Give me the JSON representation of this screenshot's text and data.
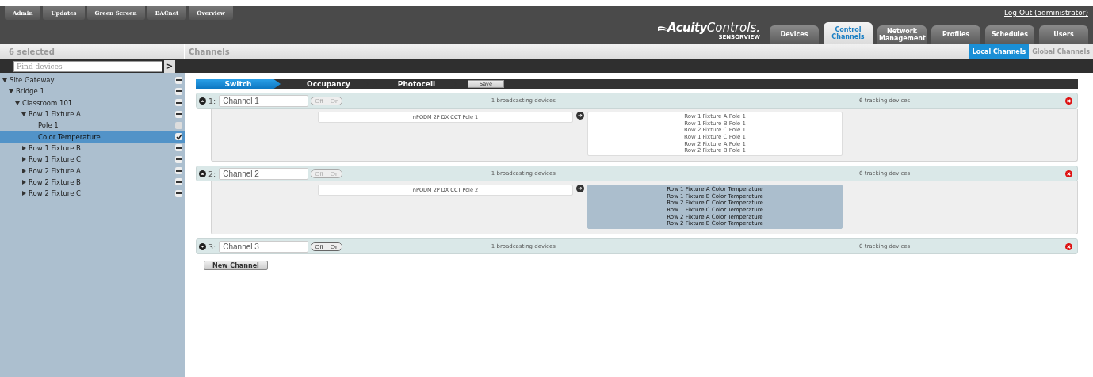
{
  "top_buttons": [
    "Admin",
    "Updates",
    "Green Screen",
    "BACnet",
    "Overview"
  ],
  "logout": "Log Out (administrator)",
  "logo": {
    "brand": "Acuity",
    "word": "Controls.",
    "product": "SENSORVIEW"
  },
  "main_tabs": [
    {
      "label": "Devices",
      "selected": false
    },
    {
      "label": "Control Channels",
      "selected": true
    },
    {
      "label": "Network Management",
      "selected": false
    },
    {
      "label": "Profiles",
      "selected": false
    },
    {
      "label": "Schedules",
      "selected": false
    },
    {
      "label": "Users",
      "selected": false
    }
  ],
  "sidebar": {
    "title": "6 selected",
    "search": {
      "placeholder": "Find devices"
    },
    "search_button": ">",
    "tree": [
      {
        "label": "Site Gateway",
        "kind": "group",
        "expanded": true,
        "selected": false,
        "children": [
          {
            "label": "Bridge 1",
            "kind": "group",
            "expanded": true,
            "selected": false,
            "children": [
              {
                "label": "Classroom 101",
                "kind": "group",
                "expanded": true,
                "selected": false,
                "children": [
                  {
                    "label": "Row 1 Fixture A",
                    "kind": "group",
                    "expanded": true,
                    "selected": false,
                    "children": [
                      {
                        "label": "Pole 1",
                        "kind": "leaf",
                        "checked": false,
                        "selected": false
                      },
                      {
                        "label": "Color Temperature",
                        "kind": "leaf",
                        "checked": true,
                        "selected": true
                      }
                    ]
                  },
                  {
                    "label": "Row 1 Fixture B",
                    "kind": "group",
                    "expanded": false,
                    "selected": false
                  },
                  {
                    "label": "Row 1 Fixture C",
                    "kind": "group",
                    "expanded": false,
                    "selected": false
                  },
                  {
                    "label": "Row 2 Fixture A",
                    "kind": "group",
                    "expanded": false,
                    "selected": false
                  },
                  {
                    "label": "Row 2 Fixture B",
                    "kind": "group",
                    "expanded": false,
                    "selected": false
                  },
                  {
                    "label": "Row 2 Fixture C",
                    "kind": "group",
                    "expanded": false,
                    "selected": false
                  }
                ]
              }
            ]
          }
        ]
      }
    ]
  },
  "content": {
    "title": "Channels",
    "sub_tabs": [
      {
        "label": "Local Channels",
        "selected": true
      },
      {
        "label": "Global Channels",
        "selected": false
      }
    ],
    "steps": [
      {
        "label": "Switch",
        "selected": true
      },
      {
        "label": "Occupancy",
        "selected": false
      },
      {
        "label": "Photocell",
        "selected": false
      }
    ],
    "save_button": "Save",
    "channels": [
      {
        "number": "1:",
        "name": "Channel 1",
        "expanded": true,
        "toggle_disabled": true,
        "toggle": [
          "Off",
          "On"
        ],
        "broadcasting": "1 broadcasting devices",
        "tracking": "6 tracking devices",
        "source": "nPODM 2P DX CCT Pole 1",
        "arrow": "➜",
        "targets_selected": false,
        "targets": [
          "Row 1 Fixture A Pole 1",
          "Row 1 Fixture B Pole 1",
          "Row 2 Fixture C Pole 1",
          "Row 1 Fixture C Pole 1",
          "Row 2 Fixture A Pole 1",
          "Row 2 Fixture B Pole 1"
        ]
      },
      {
        "number": "2:",
        "name": "Channel 2",
        "expanded": true,
        "toggle_disabled": true,
        "toggle": [
          "Off",
          "On"
        ],
        "broadcasting": "1 broadcasting devices",
        "tracking": "6 tracking devices",
        "source": "nPODM 2P DX CCT Pole 2",
        "arrow": "➜",
        "targets_selected": true,
        "targets": [
          "Row 1 Fixture A Color Temperature",
          "Row 1 Fixture B Color Temperature",
          "Row 2 Fixture C Color Temperature",
          "Row 1 Fixture C Color Temperature",
          "Row 2 Fixture A Color Temperature",
          "Row 2 Fixture B Color Temperature"
        ]
      },
      {
        "number": "3:",
        "name": "Channel 3",
        "expanded": false,
        "toggle_disabled": false,
        "toggle": [
          "Off",
          "On"
        ],
        "broadcasting": "1 broadcasting devices",
        "tracking": "0 tracking devices"
      }
    ],
    "new_channel_button": "New Channel"
  }
}
